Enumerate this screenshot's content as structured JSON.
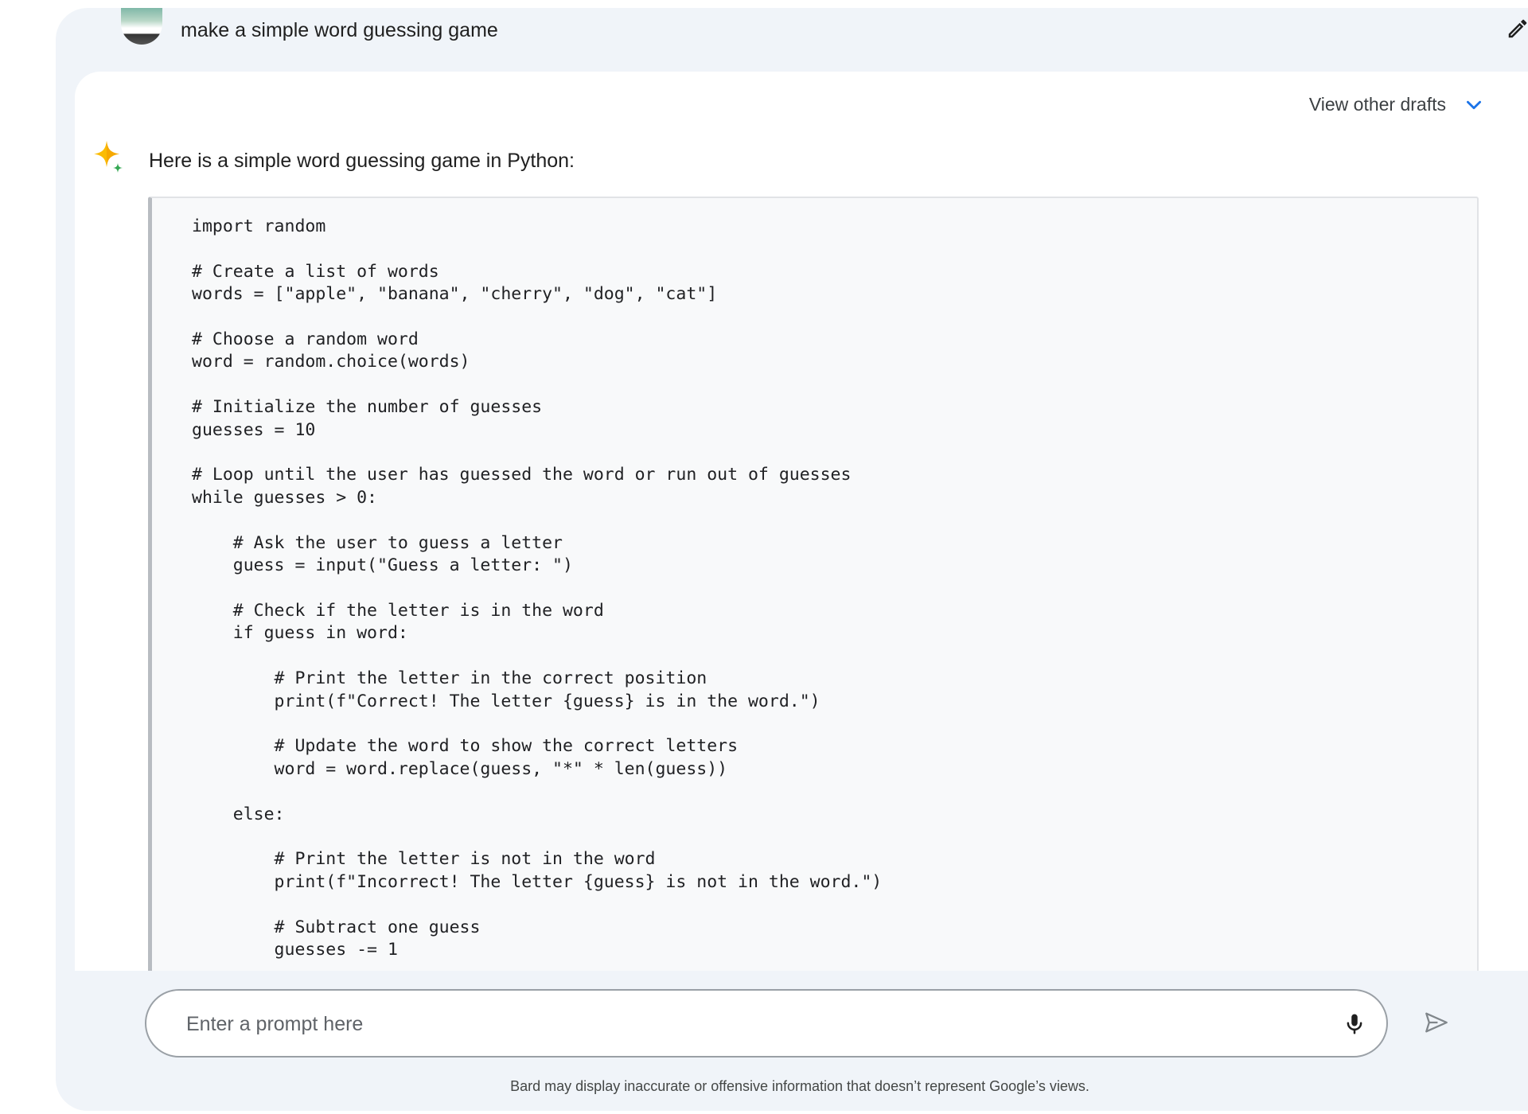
{
  "user_prompt": {
    "text": "make a simple word guessing game"
  },
  "response": {
    "drafts_label": "View other drafts",
    "intro": "Here is a simple word guessing game in Python:",
    "code": "import random\n\n# Create a list of words\nwords = [\"apple\", \"banana\", \"cherry\", \"dog\", \"cat\"]\n\n# Choose a random word\nword = random.choice(words)\n\n# Initialize the number of guesses\nguesses = 10\n\n# Loop until the user has guessed the word or run out of guesses\nwhile guesses > 0:\n\n    # Ask the user to guess a letter\n    guess = input(\"Guess a letter: \")\n\n    # Check if the letter is in the word\n    if guess in word:\n\n        # Print the letter in the correct position\n        print(f\"Correct! The letter {guess} is in the word.\")\n\n        # Update the word to show the correct letters\n        word = word.replace(guess, \"*\" * len(guess))\n\n    else:\n\n        # Print the letter is not in the word\n        print(f\"Incorrect! The letter {guess} is not in the word.\")\n\n        # Subtract one guess\n        guesses -= 1"
  },
  "input": {
    "placeholder": "Enter a prompt here",
    "value": ""
  },
  "footer": {
    "disclaimer": "Bard may display inaccurate or offensive information that doesn’t represent Google’s views."
  },
  "icons": {
    "edit": "pencil-icon",
    "chevron": "chevron-down-icon",
    "sparkle": "bard-sparkle-icon",
    "mic": "microphone-icon",
    "send": "send-icon"
  },
  "colors": {
    "background": "#f0f4f9",
    "card": "#ffffff",
    "code_background": "#f8f9fa",
    "accent_blue": "#1a73e8",
    "sparkle_yellow": "#fbbc04",
    "sparkle_green": "#34a853"
  }
}
